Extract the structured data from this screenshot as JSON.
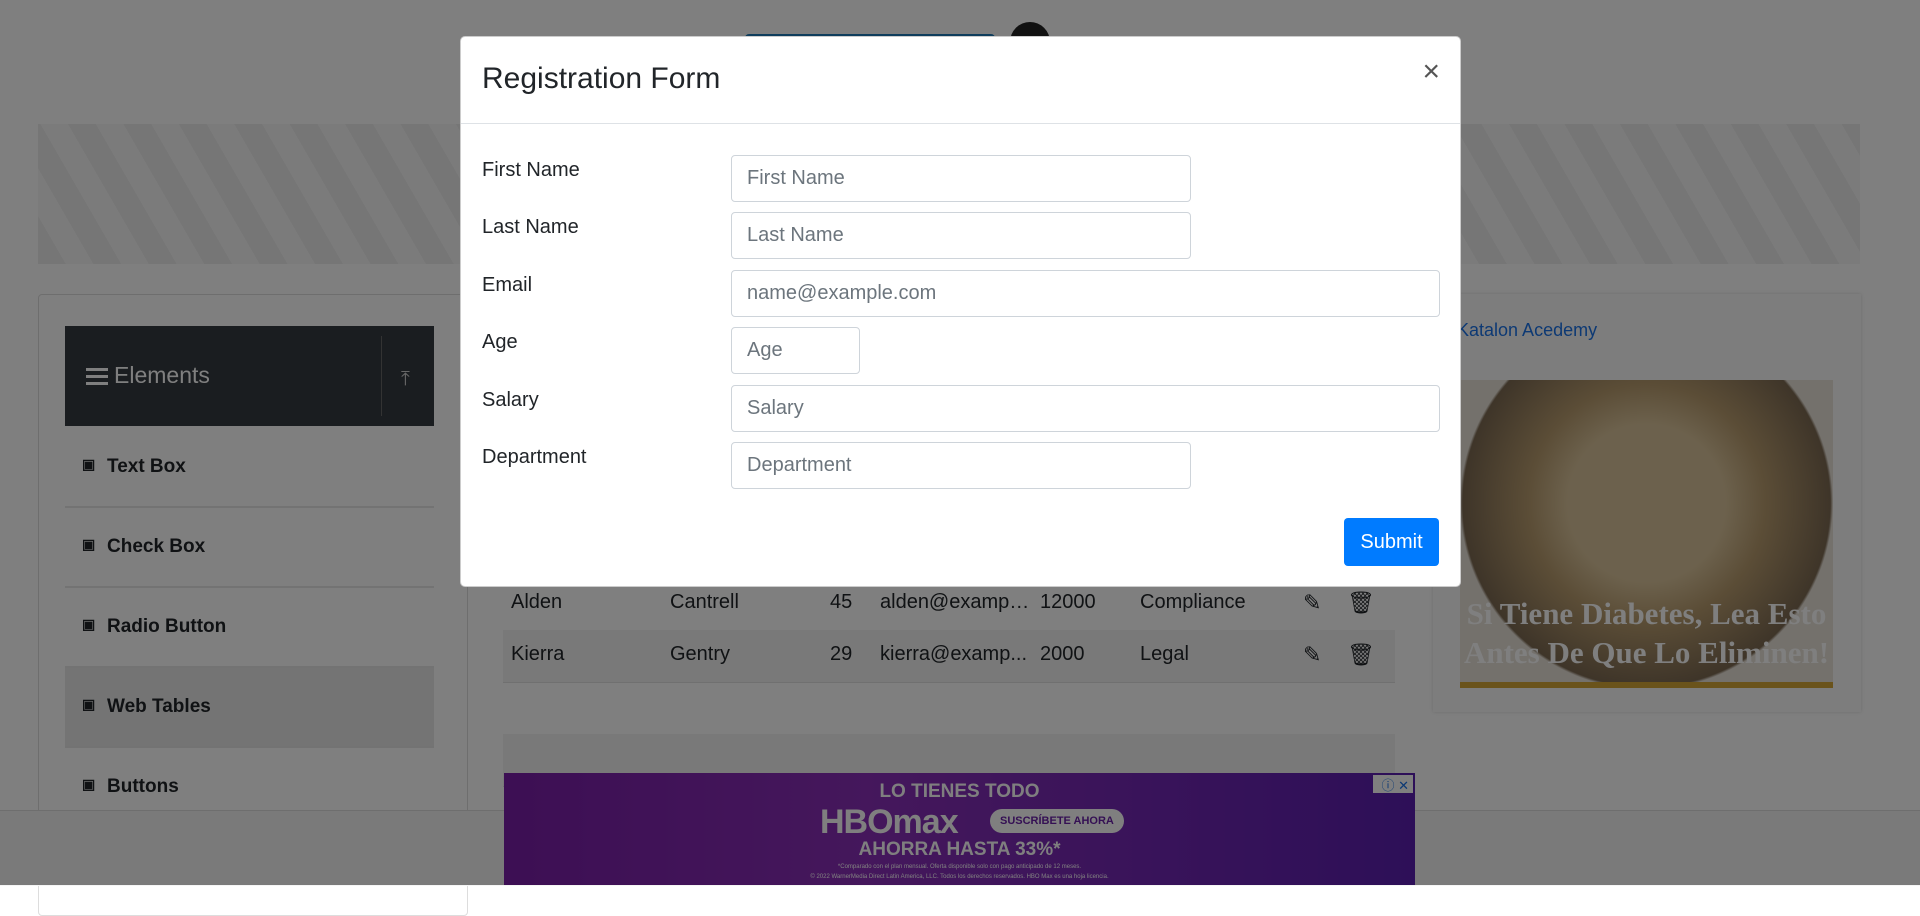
{
  "modal": {
    "title": "Registration Form",
    "close_label": "×",
    "fields": [
      {
        "label": "First Name",
        "placeholder": "First Name"
      },
      {
        "label": "Last Name",
        "placeholder": "Last Name"
      },
      {
        "label": "Email",
        "placeholder": "name@example.com"
      },
      {
        "label": "Age",
        "placeholder": "Age"
      },
      {
        "label": "Salary",
        "placeholder": "Salary"
      },
      {
        "label": "Department",
        "placeholder": "Department"
      }
    ],
    "submit_label": "Submit"
  },
  "sidebar": {
    "group_title": "Elements",
    "items": [
      {
        "label": "Text Box"
      },
      {
        "label": "Check Box"
      },
      {
        "label": "Radio Button"
      },
      {
        "label": "Web Tables"
      },
      {
        "label": "Buttons"
      }
    ]
  },
  "table": {
    "rows": [
      {
        "first": "Alden",
        "last": "Cantrell",
        "age": "45",
        "email": "alden@exampl...",
        "salary": "12000",
        "department": "Compliance"
      },
      {
        "first": "Kierra",
        "last": "Gentry",
        "age": "29",
        "email": "kierra@examp...",
        "salary": "2000",
        "department": "Legal"
      }
    ]
  },
  "right_ad": {
    "alt_text": "Katalon Acedemy",
    "headline": "Si Tiene Diabetes, Lea Esto Antes De Que Lo Eliminen!"
  },
  "bottom_ad": {
    "line1": "LO TIENES TODO",
    "brand": "HBOmax",
    "cta": "SUSCRÍBETE AHORA",
    "line3": "AHORRA HASTA 33%*",
    "fine1": "*Comparado con el plan mensual. Oferta disponible solo con pago anticipado de 12 meses.",
    "fine2": "© 2022 WarnerMedia Direct Latin America, LLC. Todos los derechos reservados. HBO Max es una hoja licencia."
  },
  "colors": {
    "primary": "#007bff",
    "sidebar_header": "#343a40",
    "backdrop": "rgba(0,0,0,0.5)"
  }
}
